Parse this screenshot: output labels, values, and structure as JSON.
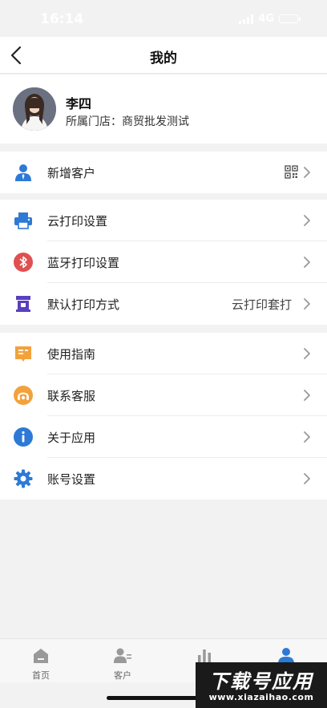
{
  "status_bar": {
    "time": "16:14",
    "network": "4G"
  },
  "header": {
    "title": "我的"
  },
  "profile": {
    "name": "李四",
    "store_label": "所属门店：",
    "store_name": "商贸批发测试"
  },
  "menu_groups": [
    [
      {
        "label": "新增客户",
        "icon": "user-icon",
        "color": "#2d7ad6"
      }
    ],
    [
      {
        "label": "云打印设置",
        "icon": "printer-icon",
        "color": "#2d7ad6"
      },
      {
        "label": "蓝牙打印设置",
        "icon": "bluetooth-icon",
        "color": "#e05050"
      },
      {
        "label": "默认打印方式",
        "value": "云打印套打",
        "icon": "print-mode-icon",
        "color": "#5b3fbf"
      }
    ],
    [
      {
        "label": "使用指南",
        "icon": "guide-icon",
        "color": "#f2a23c"
      },
      {
        "label": "联系客服",
        "icon": "headset-icon",
        "color": "#f2a23c"
      },
      {
        "label": "关于应用",
        "icon": "info-icon",
        "color": "#2d7ad6"
      },
      {
        "label": "账号设置",
        "icon": "gear-icon",
        "color": "#2d7ad6"
      }
    ]
  ],
  "tabbar": {
    "tabs": [
      {
        "label": "首页",
        "icon": "home-icon"
      },
      {
        "label": "客户",
        "icon": "customer-icon"
      },
      {
        "label": "",
        "icon": "stats-icon"
      },
      {
        "label": "",
        "icon": "profile-icon"
      }
    ],
    "active_index": 3
  },
  "watermark": {
    "main": "下载号应用",
    "sub": "www.xiazaihao.com"
  }
}
